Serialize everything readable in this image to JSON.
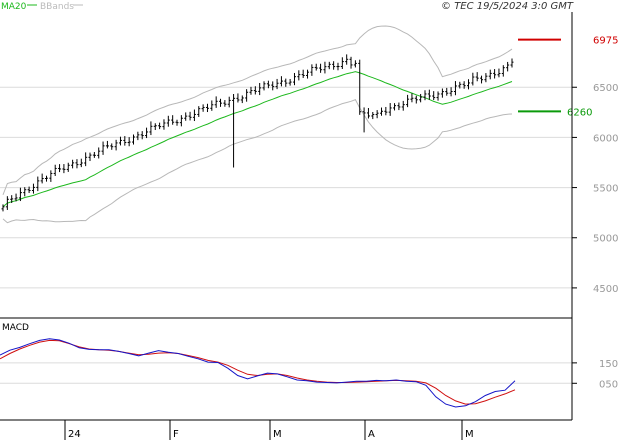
{
  "header": {
    "legend_ma": "MA20",
    "legend_bbands": "BBands",
    "copyright": "© TEC 19/5/2024 3:0 GMT"
  },
  "colors": {
    "candle": "#000000",
    "ma20": "#1db81d",
    "bbands": "#b8b8b8",
    "macd": "#1515c8",
    "signal": "#d01010",
    "target_high": "#d00000",
    "target_low": "#0a9a0a",
    "grid": "#dcdcdc",
    "axis_text": "#999999"
  },
  "chart_data": [
    {
      "type": "candlestick",
      "name": "price",
      "xlabel": "",
      "ylabel": "",
      "ylim": [
        4200,
        7250
      ],
      "x_tick_labels": [
        "24",
        "F",
        "M",
        "A",
        "M"
      ],
      "y_tick_labels": [
        "6500",
        "6000",
        "5500",
        "5000",
        "4500"
      ],
      "grid": true,
      "legend": "top-left",
      "series": [
        {
          "name": "MA20",
          "start": 5070,
          "end": 6440
        },
        {
          "name": "BBands"
        }
      ],
      "annotations": [
        {
          "label": "6975",
          "value": 6975,
          "kind": "target_high"
        },
        {
          "label": "6260",
          "value": 6260,
          "kind": "target_low"
        }
      ],
      "ohlc_summary": {
        "approx_start_close": 5290,
        "approx_low_close": 5300,
        "approx_peak_close": 6780,
        "approx_last_close": 6750,
        "sharp_drop_low": 6050
      }
    },
    {
      "type": "line",
      "name": "MACD",
      "title": "MACD",
      "ylim": [
        -120,
        360
      ],
      "y_tick_labels": [
        "150",
        "050"
      ],
      "y_tick_values": [
        150,
        50
      ],
      "series": [
        {
          "name": "MACD",
          "values": [
            188,
            212,
            226,
            244,
            260,
            268,
            262,
            246,
            224,
            216,
            214,
            214,
            206,
            196,
            184,
            198,
            210,
            202,
            196,
            182,
            170,
            154,
            152,
            124,
            88,
            72,
            86,
            100,
            96,
            82,
            66,
            62,
            56,
            54,
            52,
            56,
            60,
            60,
            64,
            62,
            66,
            60,
            58,
            40,
            -16,
            -52,
            -66,
            -60,
            -40,
            -10,
            10,
            16,
            62
          ]
        },
        {
          "name": "Signal",
          "values": [
            170,
            196,
            218,
            236,
            252,
            260,
            258,
            244,
            228,
            218,
            214,
            212,
            206,
            198,
            190,
            192,
            198,
            200,
            196,
            186,
            176,
            162,
            154,
            138,
            114,
            94,
            88,
            94,
            96,
            88,
            76,
            66,
            60,
            56,
            54,
            54,
            56,
            58,
            60,
            62,
            64,
            62,
            60,
            52,
            26,
            -10,
            -36,
            -52,
            -50,
            -36,
            -18,
            -2,
            18
          ]
        }
      ]
    }
  ]
}
